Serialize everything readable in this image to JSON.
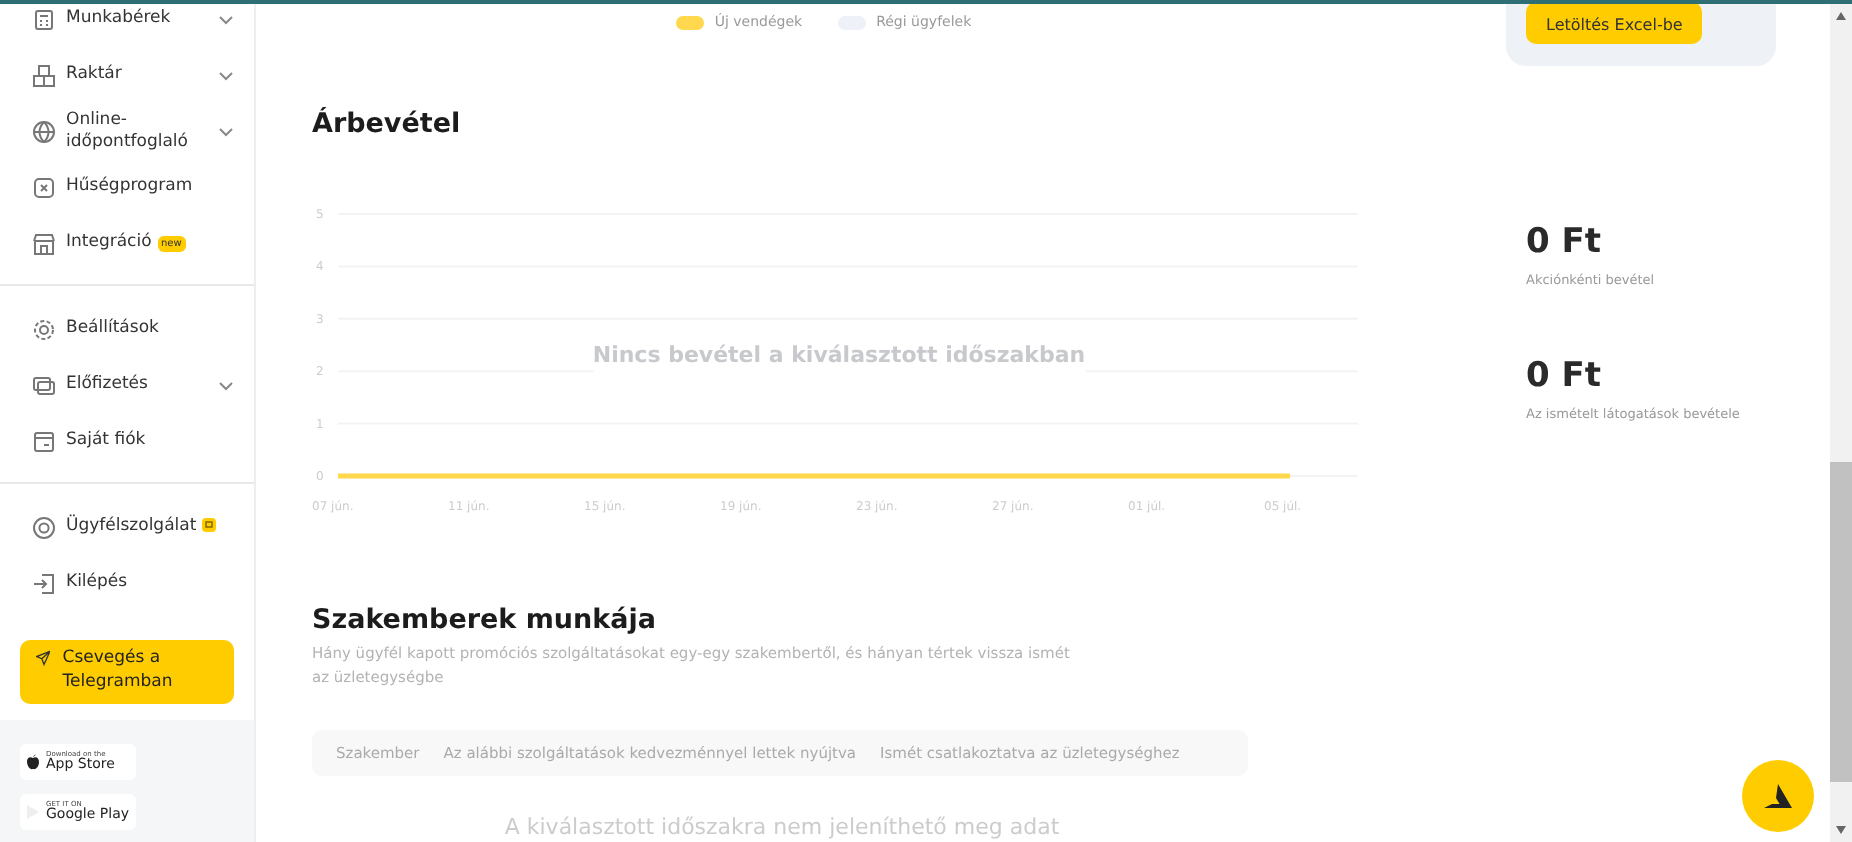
{
  "sidebar": {
    "groups": [
      {
        "items": [
          {
            "label": "Munkabérek",
            "expandable": true
          },
          {
            "label": "Raktár",
            "expandable": true
          },
          {
            "label": "Online-időpontfoglaló",
            "expandable": true
          },
          {
            "label": "Hűségprogram",
            "expandable": false
          },
          {
            "label": "Integráció",
            "expandable": false,
            "badge": "new"
          }
        ]
      },
      {
        "items": [
          {
            "label": "Beállítások",
            "expandable": false
          },
          {
            "label": "Előfizetés",
            "expandable": true
          },
          {
            "label": "Saját fiók",
            "expandable": false
          }
        ]
      },
      {
        "items": [
          {
            "label": "Ügyfélszolgálat",
            "expandable": false,
            "badge_icon": true
          },
          {
            "label": "Kilépés",
            "expandable": false
          }
        ]
      }
    ],
    "telegram_button": "Csevegés a Telegramban",
    "store_badges": [
      {
        "kind": "apple",
        "small": "Download on the",
        "big": "App Store"
      },
      {
        "kind": "google",
        "small": "GET IT ON",
        "big": "Google Play"
      }
    ]
  },
  "legend": [
    {
      "label": "Új vendégek",
      "color": "#ffd84d"
    },
    {
      "label": "Régi ügyfelek",
      "color": "#eef1f8"
    }
  ],
  "export_button": "Letöltés Excel-be",
  "revenue": {
    "title": "Árbevétel",
    "empty_message": "Nincs bevétel a kiválasztott időszakban",
    "chart_data": {
      "type": "line",
      "categories": [
        "07 jún.",
        "11 jún.",
        "15 jún.",
        "19 jún.",
        "23 jún.",
        "27 jún.",
        "01 júl.",
        "05 júl."
      ],
      "series": [
        {
          "color": "#ffd84d",
          "values": [
            0,
            0,
            0,
            0,
            0,
            0,
            0,
            0
          ]
        }
      ],
      "yticks": [
        0,
        1,
        2,
        3,
        4,
        5
      ],
      "ylim": [
        0,
        5
      ],
      "grid": true
    },
    "stats": [
      {
        "value": "0 Ft",
        "caption": "Akciónkénti bevétel"
      },
      {
        "value": "0 Ft",
        "caption": "Az ismételt látogatások bevétele"
      }
    ]
  },
  "specialists": {
    "title": "Szakemberek munkája",
    "subtitle": "Hány ügyfél kapott promóciós szolgáltatásokat egy-egy szakembertől, és hányan tértek vissza ismét az üzletegységbe",
    "columns": [
      "Szakember",
      "Az alábbi szolgáltatások kedvezménnyel lettek nyújtva",
      "Ismét csatlakoztatva az üzletegységhez"
    ],
    "empty_message": "A kiválasztott időszakra nem jeleníthető meg adat"
  }
}
